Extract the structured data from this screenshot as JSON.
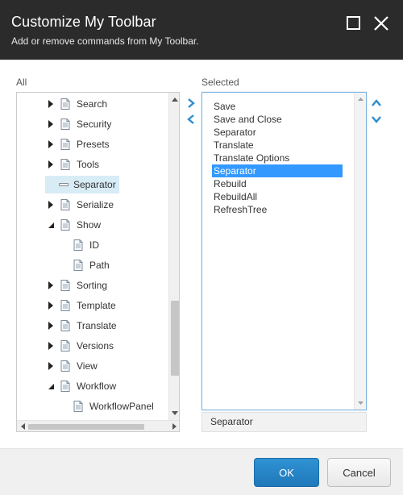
{
  "dialog": {
    "title": "Customize My Toolbar",
    "subtitle": "Add or remove commands from My Toolbar.",
    "maximize_icon": "maximize-icon",
    "close_icon": "close-icon"
  },
  "all_panel": {
    "label": "All",
    "items": [
      {
        "label": "Search",
        "expander": "collapsed",
        "icon": "document-icon",
        "level": 0,
        "selected": false
      },
      {
        "label": "Security",
        "expander": "collapsed",
        "icon": "document-icon",
        "level": 0,
        "selected": false
      },
      {
        "label": "Presets",
        "expander": "collapsed",
        "icon": "document-icon",
        "level": 0,
        "selected": false
      },
      {
        "label": "Tools",
        "expander": "collapsed",
        "icon": "document-icon",
        "level": 0,
        "selected": false
      },
      {
        "label": "Separator",
        "expander": "none",
        "icon": "separator-icon",
        "level": 0,
        "selected": true
      },
      {
        "label": "Serialize",
        "expander": "collapsed",
        "icon": "document-icon",
        "level": 0,
        "selected": false
      },
      {
        "label": "Show",
        "expander": "expanded",
        "icon": "document-icon",
        "level": 0,
        "selected": false
      },
      {
        "label": "ID",
        "expander": "none",
        "icon": "document-icon",
        "level": 1,
        "selected": false
      },
      {
        "label": "Path",
        "expander": "none",
        "icon": "document-icon",
        "level": 1,
        "selected": false
      },
      {
        "label": "Sorting",
        "expander": "collapsed",
        "icon": "document-icon",
        "level": 0,
        "selected": false
      },
      {
        "label": "Template",
        "expander": "collapsed",
        "icon": "document-icon",
        "level": 0,
        "selected": false
      },
      {
        "label": "Translate",
        "expander": "collapsed",
        "icon": "document-icon",
        "level": 0,
        "selected": false
      },
      {
        "label": "Versions",
        "expander": "collapsed",
        "icon": "document-icon",
        "level": 0,
        "selected": false
      },
      {
        "label": "View",
        "expander": "collapsed",
        "icon": "document-icon",
        "level": 0,
        "selected": false
      },
      {
        "label": "Workflow",
        "expander": "expanded",
        "icon": "document-icon",
        "level": 0,
        "selected": false
      },
      {
        "label": "WorkflowPanel",
        "expander": "none",
        "icon": "document-icon",
        "level": 1,
        "selected": false
      }
    ]
  },
  "selected_panel": {
    "label": "Selected",
    "items": [
      {
        "label": "Save",
        "selected": false
      },
      {
        "label": "Save and Close",
        "selected": false
      },
      {
        "label": "Separator",
        "selected": false
      },
      {
        "label": "Translate",
        "selected": false
      },
      {
        "label": "Translate Options",
        "selected": false
      },
      {
        "label": "Separator",
        "selected": true
      },
      {
        "label": "Rebuild",
        "selected": false
      },
      {
        "label": "RebuildAll",
        "selected": false
      },
      {
        "label": "RefreshTree",
        "selected": false
      }
    ],
    "selected_value": "Separator"
  },
  "transfer_buttons": {
    "add_icon": "chevron-right-icon",
    "remove_icon": "chevron-left-icon",
    "move_up_icon": "chevron-up-icon",
    "move_down_icon": "chevron-down-icon"
  },
  "footer": {
    "ok_label": "OK",
    "cancel_label": "Cancel"
  },
  "colors": {
    "header_bg": "#2b2b2b",
    "accent": "#2b8ed2",
    "selection": "#3399ff",
    "tree_selection": "#d8ecf6"
  }
}
